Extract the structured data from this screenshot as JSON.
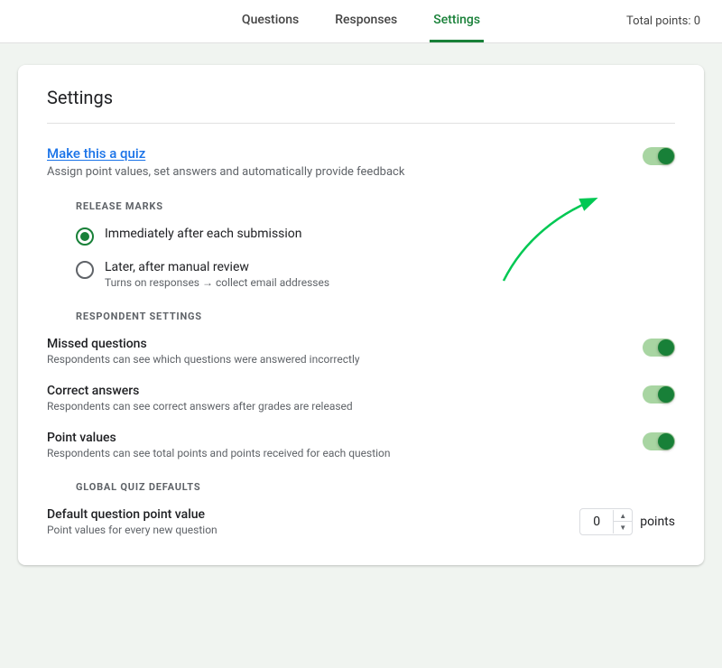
{
  "nav": {
    "tabs": [
      {
        "id": "questions",
        "label": "Questions",
        "active": false
      },
      {
        "id": "responses",
        "label": "Responses",
        "active": false
      },
      {
        "id": "settings",
        "label": "Settings",
        "active": true
      }
    ],
    "total_points_label": "Total points: 0"
  },
  "settings": {
    "title": "Settings",
    "quiz_section": {
      "title": "Make this a quiz",
      "description": "Assign point values, set answers and automatically provide feedback",
      "toggle_on": true
    },
    "release_marks": {
      "section_header": "RELEASE MARKS",
      "options": [
        {
          "id": "immediately",
          "label": "Immediately after each submission",
          "checked": true,
          "sublabel": ""
        },
        {
          "id": "later",
          "label": "Later, after manual review",
          "checked": false,
          "sublabel": "Turns on responses → collect email addresses"
        }
      ]
    },
    "respondent_settings": {
      "section_header": "RESPONDENT SETTINGS",
      "items": [
        {
          "id": "missed-questions",
          "title": "Missed questions",
          "description": "Respondents can see which questions were answered incorrectly",
          "toggle_on": true
        },
        {
          "id": "correct-answers",
          "title": "Correct answers",
          "description": "Respondents can see correct answers after grades are released",
          "toggle_on": true
        },
        {
          "id": "point-values",
          "title": "Point values",
          "description": "Respondents can see total points and points received for each question",
          "toggle_on": true
        }
      ]
    },
    "global_quiz_defaults": {
      "section_header": "GLOBAL QUIZ DEFAULTS",
      "default_point_value": {
        "title": "Default question point value",
        "description": "Point values for every new question",
        "value": "0",
        "points_label": "points"
      }
    }
  }
}
